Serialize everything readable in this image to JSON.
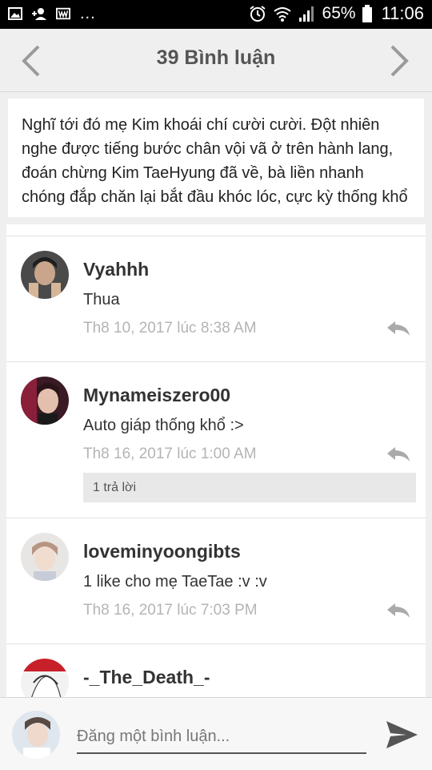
{
  "status_bar": {
    "left_icons": [
      "image-icon",
      "person-add-icon",
      "wattpad-icon"
    ],
    "more": "...",
    "battery_percent": "65%",
    "time": "11:06"
  },
  "header": {
    "title": "39 Bình luận"
  },
  "excerpt": {
    "text": "Nghĩ tới đó mẹ Kim khoái chí cười cười. Đột nhiên nghe được tiếng bước chân vội vã ở trên hành lang, đoán chừng Kim TaeHyung đã về, bà liền nhanh chóng đắp chăn lại bắt đầu khóc lóc, cực kỳ thống khổ"
  },
  "comments": [
    {
      "author": "Vyahhh",
      "text": "Thua",
      "time": "Th8 10, 2017 lúc 8:38 AM"
    },
    {
      "author": "Mynameiszero00",
      "text": "Auto giáp thống khổ  :>",
      "time": "Th8 16, 2017 lúc 1:00 AM",
      "replies": "1 trả lời"
    },
    {
      "author": "loveminyoongibts",
      "text": "1 like cho mẹ TaeTae :v :v",
      "time": "Th8 16, 2017 lúc 7:03 PM"
    },
    {
      "author": "-_The_Death_-",
      "text": "",
      "time": ""
    }
  ],
  "input": {
    "placeholder": "Đăng một bình luận..."
  },
  "colors": {
    "background": "#efefef",
    "timestamp": "#b4b4b4",
    "title": "#555555"
  }
}
